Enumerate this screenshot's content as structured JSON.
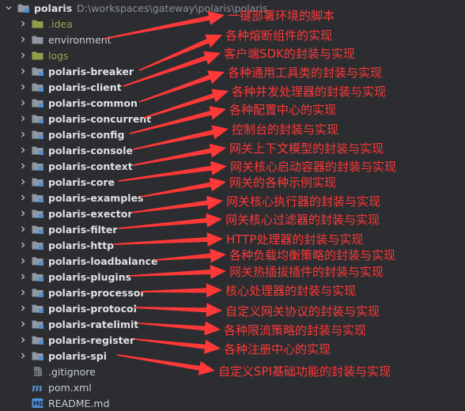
{
  "root": {
    "name": "polaris",
    "path": "D:\\workspaces\\gateway\\polaris\\polaris"
  },
  "items": [
    {
      "label": ".idea",
      "kind": "folder-plain",
      "style": "olive"
    },
    {
      "label": "environment",
      "kind": "folder-plain",
      "style": "plain"
    },
    {
      "label": "logs",
      "kind": "folder-plain",
      "style": "olive"
    },
    {
      "label": "polaris-breaker",
      "kind": "module",
      "style": "bold"
    },
    {
      "label": "polaris-client",
      "kind": "module",
      "style": "bold"
    },
    {
      "label": "polaris-common",
      "kind": "module",
      "style": "bold"
    },
    {
      "label": "polaris-concurrent",
      "kind": "module",
      "style": "bold"
    },
    {
      "label": "polaris-config",
      "kind": "module",
      "style": "bold"
    },
    {
      "label": "polaris-console",
      "kind": "module",
      "style": "bold"
    },
    {
      "label": "polaris-context",
      "kind": "module",
      "style": "bold"
    },
    {
      "label": "polaris-core",
      "kind": "module",
      "style": "bold"
    },
    {
      "label": "polaris-examples",
      "kind": "module",
      "style": "bold"
    },
    {
      "label": "polaris-exector",
      "kind": "module",
      "style": "bold"
    },
    {
      "label": "polaris-filter",
      "kind": "module",
      "style": "bold"
    },
    {
      "label": "polaris-http",
      "kind": "module",
      "style": "bold"
    },
    {
      "label": "polaris-loadbalance",
      "kind": "module",
      "style": "bold"
    },
    {
      "label": "polaris-plugins",
      "kind": "module",
      "style": "bold"
    },
    {
      "label": "polaris-processor",
      "kind": "module",
      "style": "bold"
    },
    {
      "label": "polaris-protocol",
      "kind": "module",
      "style": "bold"
    },
    {
      "label": "polaris-ratelimit",
      "kind": "module",
      "style": "bold"
    },
    {
      "label": "polaris-register",
      "kind": "module",
      "style": "bold"
    },
    {
      "label": "polaris-spi",
      "kind": "module",
      "style": "bold"
    },
    {
      "label": ".gitignore",
      "kind": "gitignore",
      "style": "plain"
    },
    {
      "label": "pom.xml",
      "kind": "maven",
      "style": "plain"
    },
    {
      "label": "README.md",
      "kind": "markdown",
      "style": "plain"
    }
  ],
  "annotations": [
    "一键部署环境的脚本",
    "各种熔断组件的实现",
    "客户端SDK的封装与实现",
    "各种通用工具类的封装与实现",
    "各种并发处理器的封装与实现",
    "各种配置中心的实现",
    "控制台的封装与实现",
    "网关上下文模型的封装与实现",
    "网关核心启动容器的封装与实现",
    "网关的各种示例实现",
    "网关核心执行器的封装与实现",
    "网关核心过滤器的封装与实现",
    "HTTP处理器的封装与实现",
    "各种负载均衡策略的封装与实现",
    "网关热插拔插件的封装与实现",
    "核心处理器的封装与实现",
    "自定义网关协议的封装与实现",
    "各种限流策略的封装与实现",
    "各种注册中心的实现",
    "自定义SPI基础功能的封装与实现"
  ],
  "colors": {
    "annotation": "#ff3838",
    "folder": "#8f98a3",
    "module_badge": "#4e8fd6",
    "olive_folder": "#8f9d4a"
  }
}
